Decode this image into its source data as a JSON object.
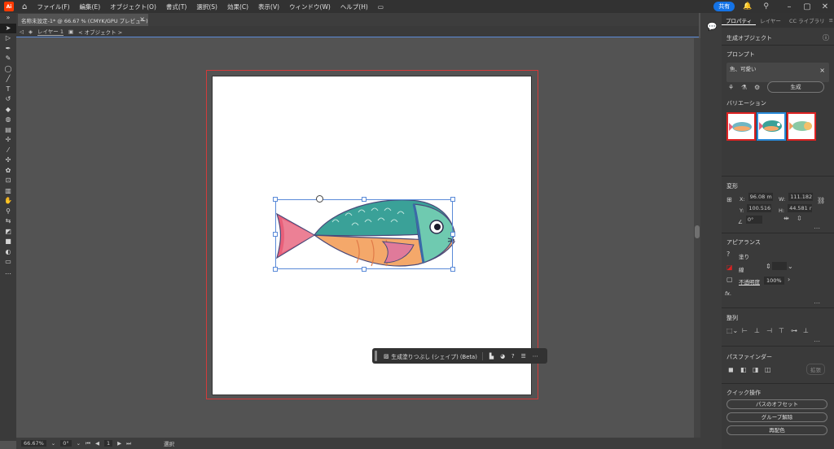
{
  "app": {
    "logo": "Ai"
  },
  "menu": [
    "ファイル(F)",
    "編集(E)",
    "オブジェクト(O)",
    "書式(T)",
    "選択(S)",
    "効果(C)",
    "表示(V)",
    "ウィンドウ(W)",
    "ヘルプ(H)"
  ],
  "share_label": "共有",
  "doc_tab": {
    "title": "名称未設定-1* @ 66.67 % (CMYK/GPU プレビュー)",
    "close": "×"
  },
  "breadcrumb": {
    "layer": "レイヤー 1",
    "object": "< オブジェクト >"
  },
  "context_bar": {
    "generate_label": "生成塗りつぶし (シェイプ) (Beta)"
  },
  "status": {
    "zoom": "66.67%",
    "rotation": "0°",
    "artboard": "1",
    "tool": "選択"
  },
  "panel": {
    "tabs": [
      "プロパティ",
      "レイヤー",
      "CC ライブラリ"
    ],
    "section_title": "生成オブジェクト",
    "prompt_title": "プロンプト",
    "prompt_text": "魚、可愛い",
    "generate_button": "生成",
    "variations_title": "バリエーション",
    "transform_title": "変形",
    "x_label": "X:",
    "x_value": "96.08 m",
    "w_label": "W:",
    "w_value": "111.182",
    "y_label": "Y:",
    "y_value": "100.516",
    "h_label": "H:",
    "h_value": "44.581 r",
    "angle_value": "0°",
    "appearance_title": "アピアランス",
    "fill_label": "塗り",
    "stroke_label": "線",
    "opacity_label": "不透明度",
    "opacity_value": "100%",
    "fx_label": "fx.",
    "align_title": "整列",
    "pathfinder_title": "パスファインダー",
    "pathfinder_expand": "拡張",
    "quick_title": "クイック操作",
    "quick_buttons": [
      "パスのオフセット",
      "グループ解除",
      "再配色"
    ]
  },
  "colors": {
    "accent": "#1473e6",
    "artboard_bleed": "#d23a3a",
    "selection": "#5a8ad8"
  }
}
